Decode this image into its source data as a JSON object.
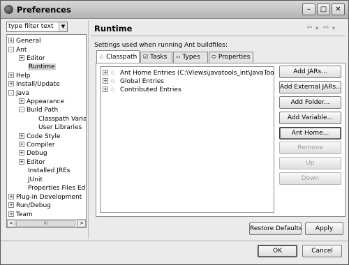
{
  "window": {
    "title": "Preferences",
    "controls": {
      "minimize": "–",
      "maximize": "□",
      "close": "✕"
    }
  },
  "filter": {
    "value": "type filter text",
    "dropdown_glyph": "▼"
  },
  "tree": {
    "items": [
      {
        "label": "General",
        "exp": "+"
      },
      {
        "label": "Ant",
        "exp": "–"
      },
      {
        "label": "Editor",
        "exp": "+"
      },
      {
        "label": "Runtime",
        "exp": "",
        "selected": true
      },
      {
        "label": "Help",
        "exp": "+"
      },
      {
        "label": "Install/Update",
        "exp": "+"
      },
      {
        "label": "Java",
        "exp": "–"
      },
      {
        "label": "Appearance",
        "exp": "+"
      },
      {
        "label": "Build Path",
        "exp": "–"
      },
      {
        "label": "Classpath Variables",
        "exp": ""
      },
      {
        "label": "User Libraries",
        "exp": ""
      },
      {
        "label": "Code Style",
        "exp": "+"
      },
      {
        "label": "Compiler",
        "exp": "+"
      },
      {
        "label": "Debug",
        "exp": "+"
      },
      {
        "label": "Editor",
        "exp": "+"
      },
      {
        "label": "Installed JREs",
        "exp": ""
      },
      {
        "label": "JUnit",
        "exp": ""
      },
      {
        "label": "Properties Files Editor",
        "exp": ""
      },
      {
        "label": "Plug-in Development",
        "exp": "+"
      },
      {
        "label": "Run/Debug",
        "exp": "+"
      },
      {
        "label": "Team",
        "exp": "+"
      }
    ],
    "scroll": {
      "left": "<",
      "right": ">",
      "thumb_grip": "III"
    }
  },
  "page": {
    "title": "Runtime",
    "nav": {
      "back": "⇦",
      "back_menu": "▾",
      "forward": "⇨",
      "forward_menu": "▾"
    },
    "description": "Settings used when running Ant buildfiles:"
  },
  "tabs": [
    {
      "label": "Classpath",
      "icon": "♘"
    },
    {
      "label": "Tasks",
      "icon": "☑"
    },
    {
      "label": "Types",
      "icon": "‹›"
    },
    {
      "label": "Properties",
      "icon": "⬭"
    }
  ],
  "classpath": {
    "entries": [
      {
        "label": "Ant Home Entries (C:\\Views\\javatools_int\\JavaTools\\ant)"
      },
      {
        "label": "Global Entries"
      },
      {
        "label": "Contributed Entries"
      }
    ],
    "entry_icon": "♘"
  },
  "buttons": {
    "add_jars": "Add JARs...",
    "add_external_jars": "Add External JARs...",
    "add_folder": "Add Folder...",
    "add_variable": "Add Variable...",
    "ant_home": "Ant Home...",
    "remove": "Remove",
    "up": "Up",
    "down": "Down",
    "restore_defaults": "Restore Defaults",
    "apply": "Apply",
    "ok": "OK",
    "cancel": "Cancel"
  }
}
